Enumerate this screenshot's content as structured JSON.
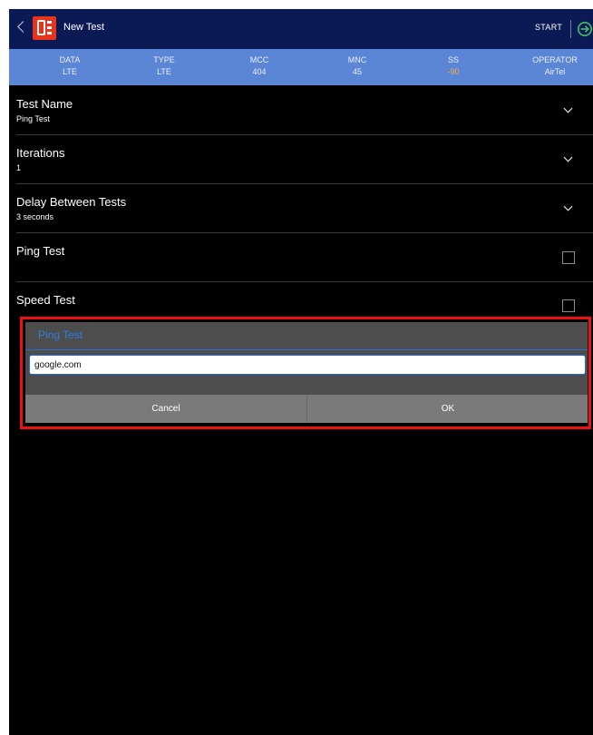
{
  "navbar": {
    "title": "New Test",
    "start_label": "START",
    "back_icon": "chevron-left-icon",
    "logo_icon": "app-logo-icon",
    "exit_icon": "exit-arrow-icon",
    "bg_color": "#0b1a55"
  },
  "info": {
    "bg_color": "#5b86d6",
    "columns": [
      {
        "label": "DATA",
        "value": "LTE"
      },
      {
        "label": "TYPE",
        "value": "LTE"
      },
      {
        "label": "MCC",
        "value": "404"
      },
      {
        "label": "MNC",
        "value": "45"
      },
      {
        "label": "SS",
        "value": "-90",
        "value_color": "#f4b03c"
      },
      {
        "label": "OPERATOR",
        "value": "AirTel"
      }
    ]
  },
  "rows": [
    {
      "title": "Test Name",
      "value": "Ping Test",
      "control": "chevron-down-icon"
    },
    {
      "title": "Iterations",
      "value": "1",
      "control": "chevron-down-icon"
    },
    {
      "title": "Delay Between Tests",
      "value": "3 seconds",
      "control": "chevron-down-icon"
    },
    {
      "title": "Ping Test",
      "control": "checkbox",
      "checked": false
    },
    {
      "title": "Speed Test",
      "control": "checkbox",
      "checked": false
    }
  ],
  "dialog": {
    "title": "Ping Test",
    "input_value": "google.com",
    "cancel_label": "Cancel",
    "ok_label": "OK",
    "highlight_color": "#ee1111",
    "title_color": "#2f7de0"
  }
}
